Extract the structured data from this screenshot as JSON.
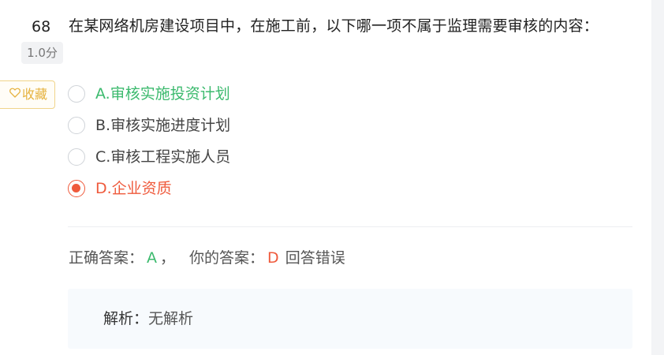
{
  "question": {
    "number": "68",
    "score": "1.0分",
    "text": "在某网络机房建设项目中，在施工前，以下哪一项不属于监理需要审核的内容："
  },
  "favorite": {
    "label": "收藏",
    "icon": "heart-outline-icon",
    "color": "#e6b23e"
  },
  "options": [
    {
      "label": "A.审核实施投资计划",
      "state": "correct"
    },
    {
      "label": "B.审核实施进度计划",
      "state": "normal"
    },
    {
      "label": "C.审核工程实施人员",
      "state": "normal"
    },
    {
      "label": "D.企业资质",
      "state": "selected-wrong"
    }
  ],
  "result": {
    "correct_label": "正确答案：",
    "correct_value": "A",
    "separator": "，",
    "your_label": "你的答案：",
    "your_value": "D",
    "status": "回答错误"
  },
  "analysis": {
    "label": "解析：",
    "value": "无解析"
  },
  "colors": {
    "correct": "#3cba6e",
    "wrong": "#ef5a3c",
    "favorite": "#e6b23e"
  }
}
